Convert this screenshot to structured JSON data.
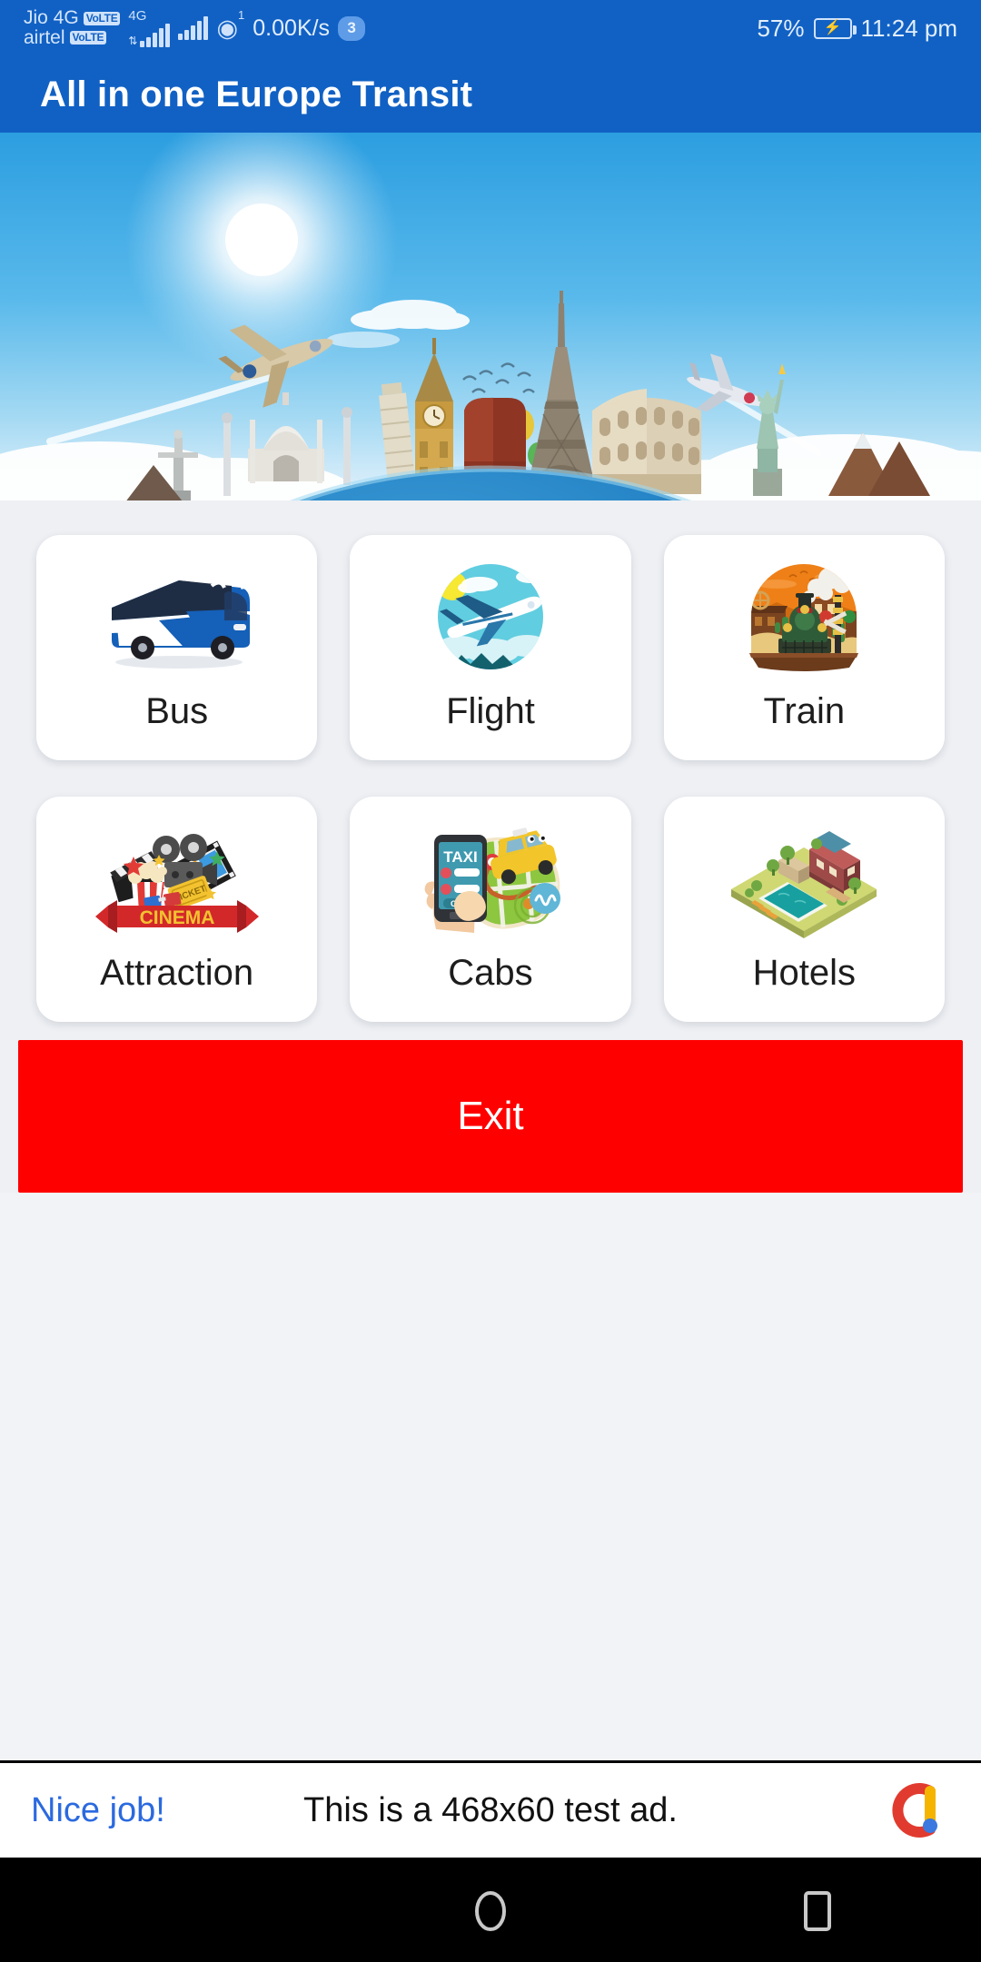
{
  "status_bar": {
    "carrier_1": "Jio 4G",
    "carrier_1_badge": "VoLTE",
    "carrier_2": "airtel",
    "carrier_2_badge": "VoLTE",
    "network_type": "4G",
    "hotspot_icon": "hotspot-icon",
    "hotspot_superscript": "1",
    "data_speed": "0.00K/s",
    "notification_count": "3",
    "battery_percent": "57%",
    "battery_state_icon": "battery-charging-icon",
    "clock": "11:24 pm"
  },
  "app_bar": {
    "title": "All in one Europe Transit"
  },
  "hero": {
    "alt": "world-landmarks-globe-banner",
    "colors": {
      "sky_top": "#2c9ee0",
      "sky_bottom": "#dff0fb",
      "ocean": "#1b74b8",
      "land": "#cfd8a8"
    }
  },
  "grid": {
    "items": [
      {
        "id": "bus",
        "label": "Bus",
        "icon": "bus-icon"
      },
      {
        "id": "flight",
        "label": "Flight",
        "icon": "flight-icon"
      },
      {
        "id": "train",
        "label": "Train",
        "icon": "train-icon"
      },
      {
        "id": "attraction",
        "label": "Attraction",
        "icon": "cinema-icon",
        "art_text": "CINEMA"
      },
      {
        "id": "cabs",
        "label": "Cabs",
        "icon": "taxi-app-icon",
        "art_text": "TAXI",
        "art_text_2": "CALL"
      },
      {
        "id": "hotels",
        "label": "Hotels",
        "icon": "hotel-resort-icon"
      }
    ]
  },
  "exit": {
    "label": "Exit",
    "color": "#ff0000"
  },
  "ad": {
    "headline": "Nice job!",
    "message": "This is a 468x60 test ad.",
    "logo": "admob-logo-icon",
    "headline_color": "#2b6adf"
  },
  "nav_bar": {
    "back": "back-icon",
    "home": "home-icon",
    "recents": "recents-icon"
  }
}
